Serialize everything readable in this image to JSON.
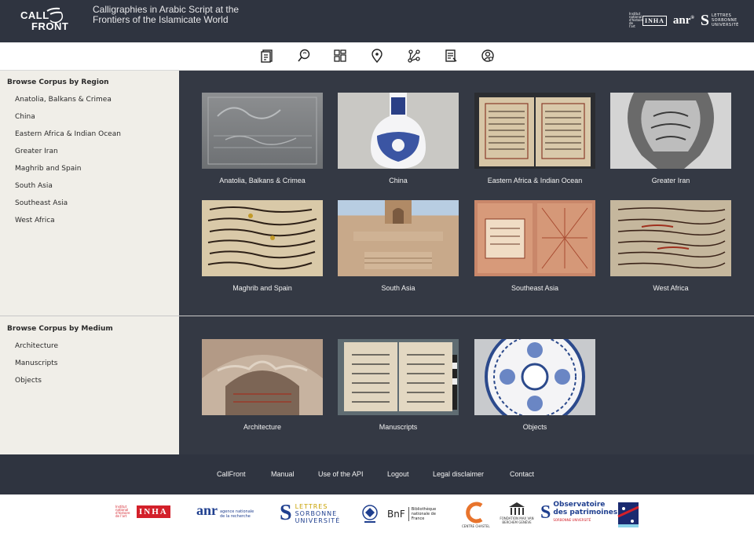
{
  "header": {
    "logo_line1": "CALL",
    "logo_line2": "FRONT",
    "title": "Calligraphies in Arabic Script at the Frontiers of the Islamicate World",
    "partners_top": {
      "inha_small_text": "Institut national d'histoire de l'art",
      "inha": "INHA",
      "anr": "anr",
      "slu_mark": "S",
      "slu_text": "LETTRES SORBONNE UNIVERSITÉ"
    }
  },
  "toolbar": {
    "icons": [
      "corpus-icon",
      "search-icon",
      "grid-icon",
      "map-pin-icon",
      "network-icon",
      "notes-icon",
      "user-icon"
    ]
  },
  "region_panel": {
    "heading": "Browse Corpus by Region",
    "items": [
      "Anatolia, Balkans & Crimea",
      "China",
      "Eastern Africa & Indian Ocean",
      "Greater Iran",
      "Maghrib and Spain",
      "South Asia",
      "Southeast Asia",
      "West Africa"
    ]
  },
  "medium_panel": {
    "heading": "Browse Corpus by Medium",
    "items": [
      "Architecture",
      "Manuscripts",
      "Objects"
    ]
  },
  "region_cards": [
    {
      "label": "Anatolia, Balkans & Crimea"
    },
    {
      "label": "China"
    },
    {
      "label": "Eastern Africa & Indian Ocean"
    },
    {
      "label": "Greater Iran"
    },
    {
      "label": "Maghrib and Spain"
    },
    {
      "label": "South Asia"
    },
    {
      "label": "Southeast Asia"
    },
    {
      "label": "West Africa"
    }
  ],
  "medium_cards": [
    {
      "label": "Architecture"
    },
    {
      "label": "Manuscripts"
    },
    {
      "label": "Objects"
    }
  ],
  "footer": {
    "links": [
      "CallFront",
      "Manual",
      "Use of the API",
      "Logout",
      "Legal disclaimer",
      "Contact"
    ]
  },
  "partners": {
    "inha_text": "Institut national d'histoire de l'art",
    "inha": "INHA",
    "anr": "anr",
    "anr_sub": "agence nationale de la recherche",
    "slu_s": "S",
    "slu_l1": "LETTRES",
    "slu_l2": "SORBONNE",
    "slu_l3": "UNIVERSITÉ",
    "bnf": "BnF",
    "bnf_sub": "Bibliothèque nationale de France",
    "chastel": "CENTRE CHASTEL",
    "fondation": "FONDATION MAX VAN BERCHEM GENÈVE",
    "obs1": "Observatoire",
    "obs2": "des patrimoines",
    "obs3": "SORBONNE UNIVERSITÉ"
  },
  "colors": {
    "header_bg": "#2f3440",
    "main_bg": "#343944",
    "sidebar_bg": "#f0eee8",
    "partner_red": "#d3202a",
    "partner_blue": "#1f3f8f"
  }
}
